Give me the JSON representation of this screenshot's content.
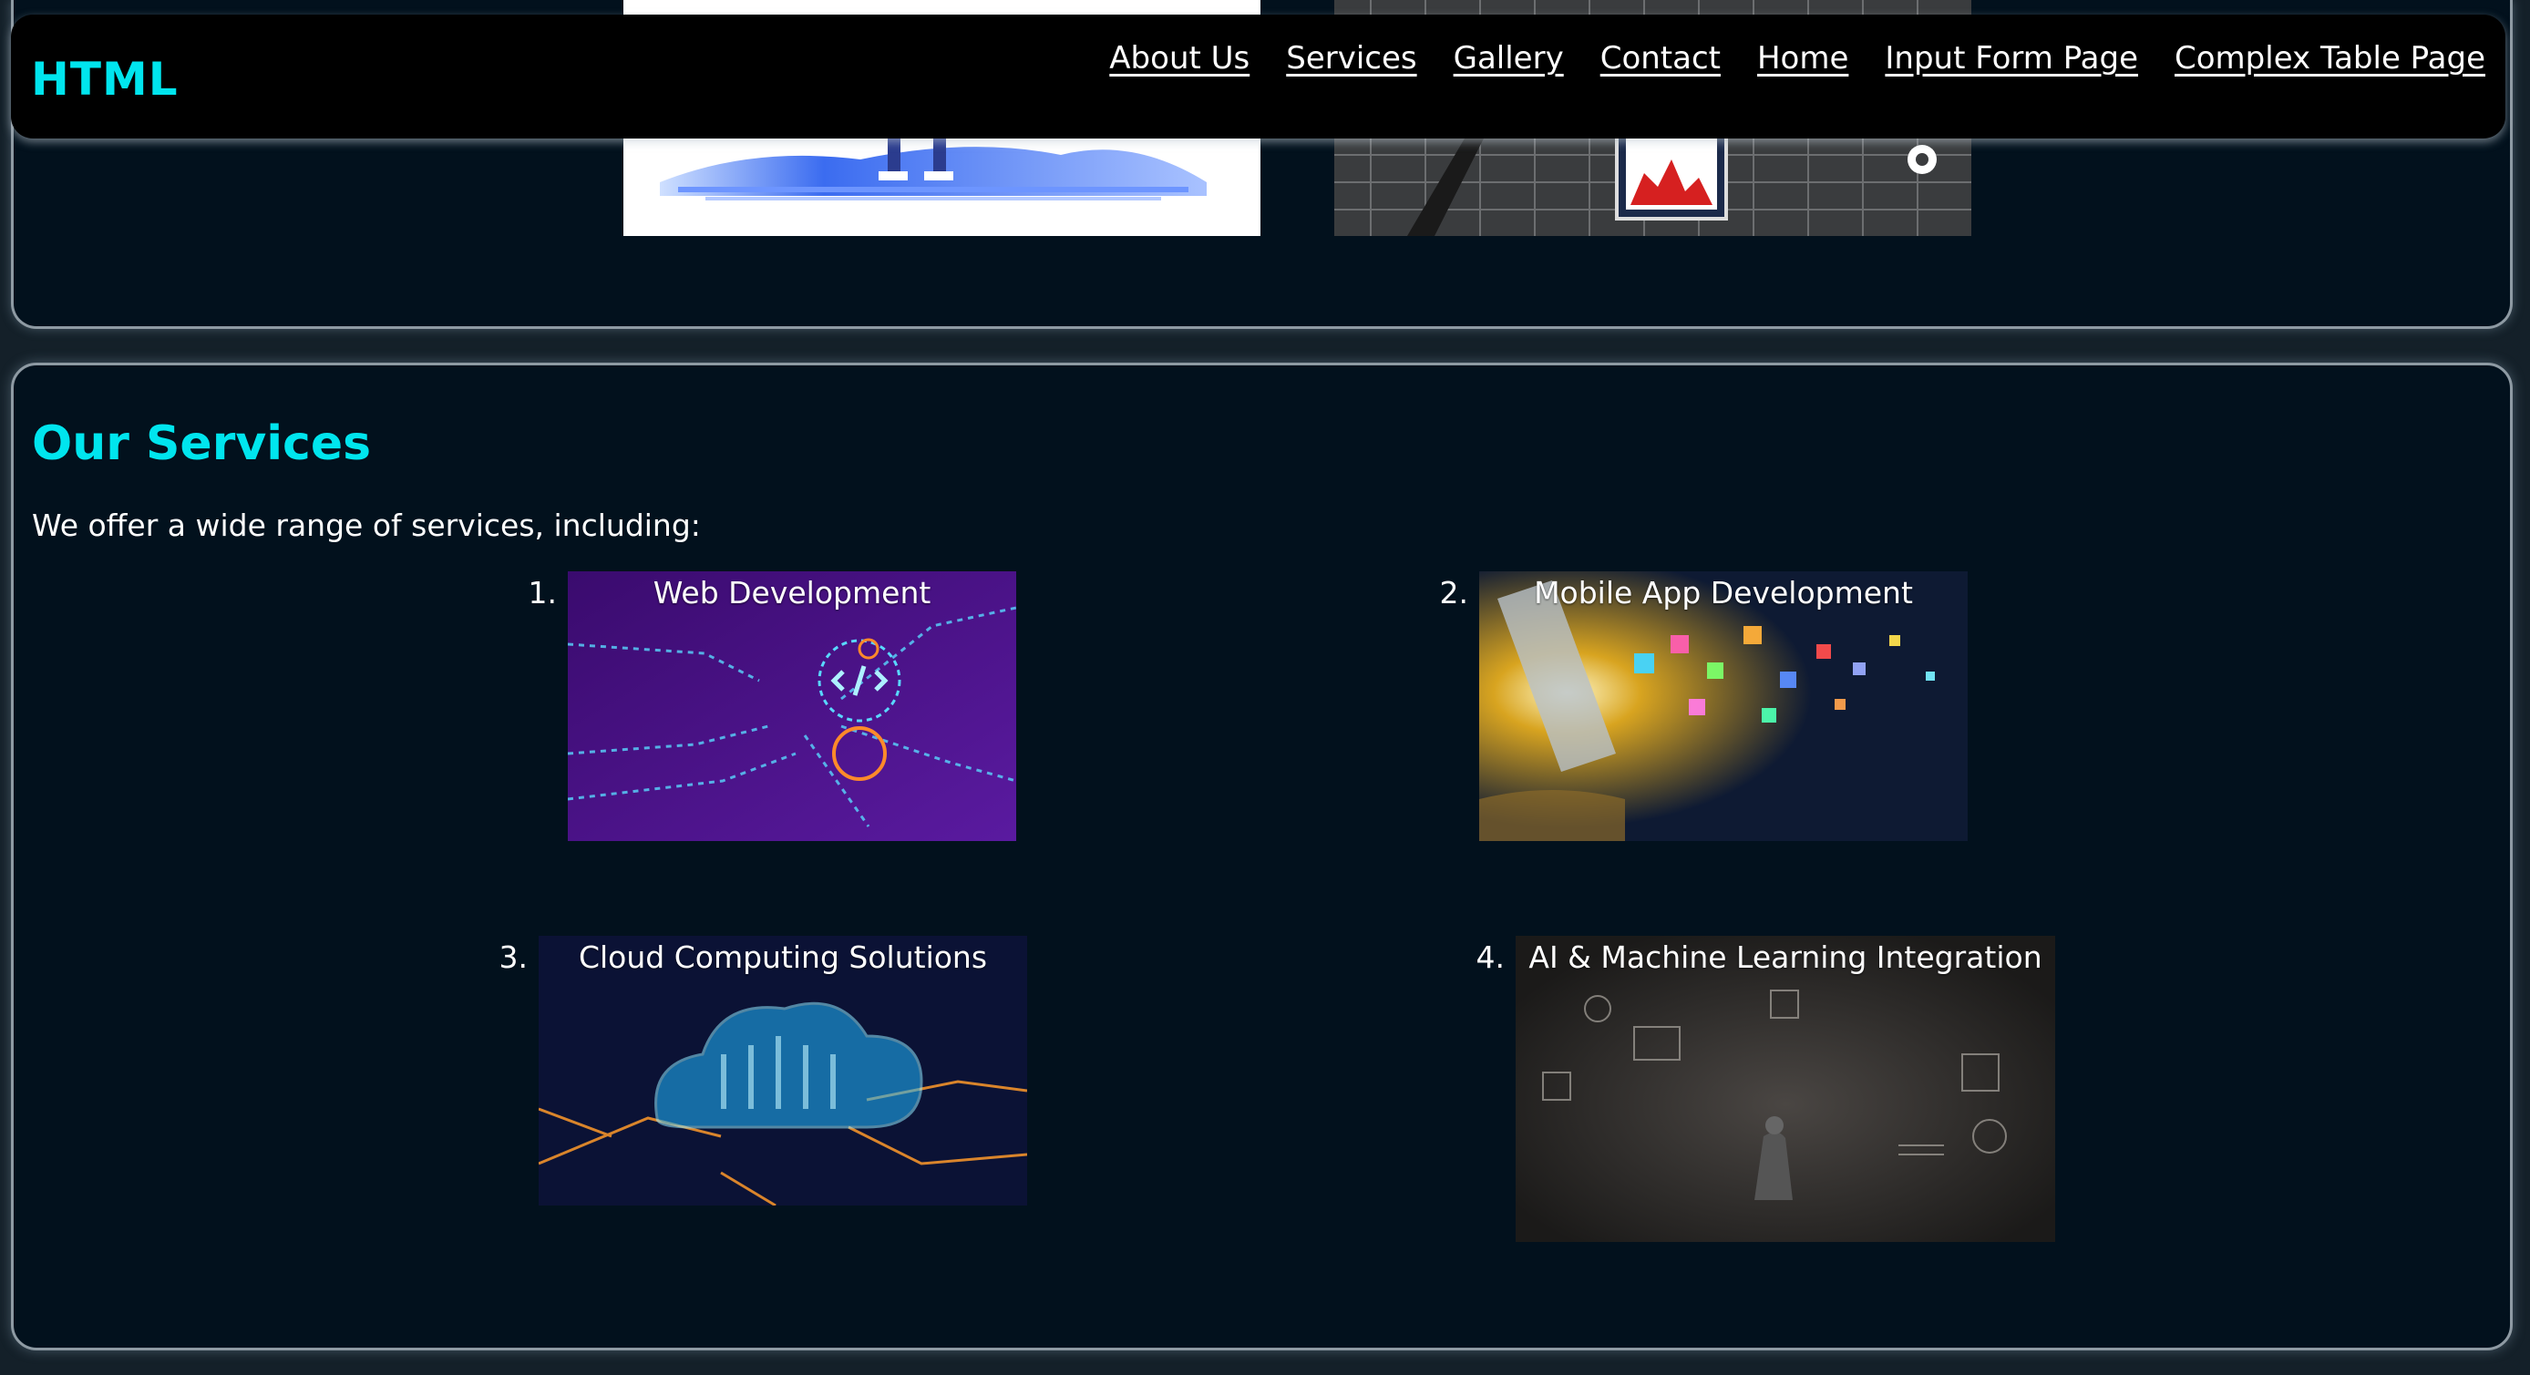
{
  "navbar": {
    "brand": "HTML",
    "links": [
      "About Us",
      "Services",
      "Gallery",
      "Contact",
      "Home",
      "Input Form Page",
      "Complex Table Page"
    ]
  },
  "services": {
    "heading": "Our Services",
    "intro": "We offer a wide range of services, including:",
    "items": [
      {
        "number": "1.",
        "title": "Web Development"
      },
      {
        "number": "2.",
        "title": "Mobile App Development"
      },
      {
        "number": "3.",
        "title": "Cloud Computing Solutions"
      },
      {
        "number": "4.",
        "title": "AI & Machine Learning Integration"
      }
    ]
  },
  "colors": {
    "accent": "#00e5ee",
    "page_bg": "#142029",
    "panel_bg": "#02111d",
    "navbar_bg": "#000000"
  }
}
